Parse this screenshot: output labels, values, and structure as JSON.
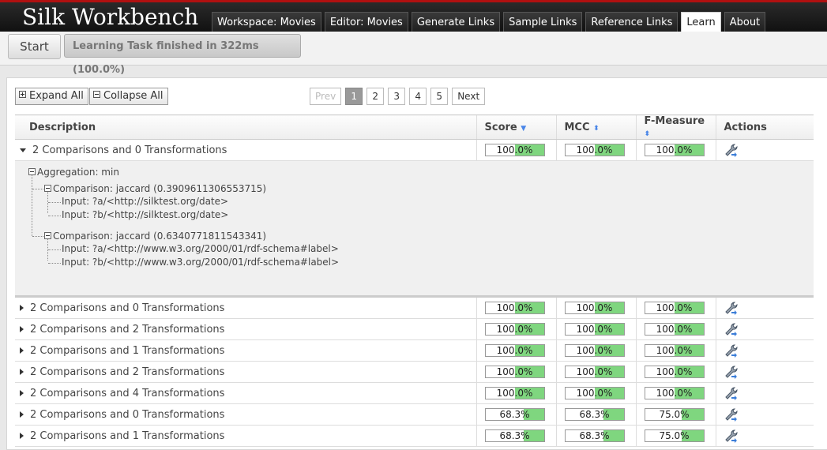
{
  "app": {
    "title": "Silk Workbench"
  },
  "nav": {
    "tabs": [
      "Workspace: Movies",
      "Editor: Movies",
      "Generate Links",
      "Sample Links",
      "Reference Links",
      "Learn",
      "About"
    ],
    "active": "Learn"
  },
  "toolbar": {
    "start_label": "Start",
    "status": "Learning Task finished in 322ms (100.0%)"
  },
  "controls": {
    "expand_all": "Expand All",
    "collapse_all": "Collapse All"
  },
  "pager": {
    "prev": "Prev",
    "pages": [
      "1",
      "2",
      "3",
      "4",
      "5"
    ],
    "current": "1",
    "next": "Next"
  },
  "table": {
    "headers": {
      "description": "Description",
      "score": "Score",
      "mcc": "MCC",
      "fmeasure": "F-Measure",
      "actions": "Actions"
    },
    "rows": [
      {
        "description": "2 Comparisons and 0 Transformations",
        "expanded": true,
        "score": "100.0%",
        "score_value": 1.0,
        "mcc": "100.0%",
        "mcc_value": 1.0,
        "fmeasure": "100.0%",
        "fmeasure_value": 1.0
      },
      {
        "description": "2 Comparisons and 0 Transformations",
        "expanded": false,
        "score": "100.0%",
        "score_value": 1.0,
        "mcc": "100.0%",
        "mcc_value": 1.0,
        "fmeasure": "100.0%",
        "fmeasure_value": 1.0
      },
      {
        "description": "2 Comparisons and 2 Transformations",
        "expanded": false,
        "score": "100.0%",
        "score_value": 1.0,
        "mcc": "100.0%",
        "mcc_value": 1.0,
        "fmeasure": "100.0%",
        "fmeasure_value": 1.0
      },
      {
        "description": "2 Comparisons and 1 Transformations",
        "expanded": false,
        "score": "100.0%",
        "score_value": 1.0,
        "mcc": "100.0%",
        "mcc_value": 1.0,
        "fmeasure": "100.0%",
        "fmeasure_value": 1.0
      },
      {
        "description": "2 Comparisons and 2 Transformations",
        "expanded": false,
        "score": "100.0%",
        "score_value": 1.0,
        "mcc": "100.0%",
        "mcc_value": 1.0,
        "fmeasure": "100.0%",
        "fmeasure_value": 1.0
      },
      {
        "description": "2 Comparisons and 4 Transformations",
        "expanded": false,
        "score": "100.0%",
        "score_value": 1.0,
        "mcc": "100.0%",
        "mcc_value": 1.0,
        "fmeasure": "100.0%",
        "fmeasure_value": 1.0
      },
      {
        "description": "2 Comparisons and 0 Transformations",
        "expanded": false,
        "score": "68.3%",
        "score_value": 0.683,
        "mcc": "68.3%",
        "mcc_value": 0.683,
        "fmeasure": "75.0%",
        "fmeasure_value": 0.75
      },
      {
        "description": "2 Comparisons and 1 Transformations",
        "expanded": false,
        "score": "68.3%",
        "score_value": 0.683,
        "mcc": "68.3%",
        "mcc_value": 0.683,
        "fmeasure": "75.0%",
        "fmeasure_value": 0.75
      }
    ]
  },
  "detail": {
    "aggregation": "Aggregation: min",
    "comparisons": [
      {
        "label": "Comparison: jaccard (0.3909611306553715)",
        "inputs": [
          "Input: ?a/<http://silktest.org/date>",
          "Input: ?b/<http://silktest.org/date>"
        ]
      },
      {
        "label": "Comparison: jaccard (0.6340771811543341)",
        "inputs": [
          "Input: ?a/<http://www.w3.org/2000/01/rdf-schema#label>",
          "Input: ?b/<http://www.w3.org/2000/01/rdf-schema#label>"
        ]
      }
    ]
  },
  "colors": {
    "bar_fill": "#7fd67f",
    "accent": "#b01010",
    "sort_arrow": "#4a86e8"
  },
  "icons": {
    "sort": "sort-arrows-icon",
    "action": "wrench-icon",
    "expander": "triangle-icon"
  }
}
